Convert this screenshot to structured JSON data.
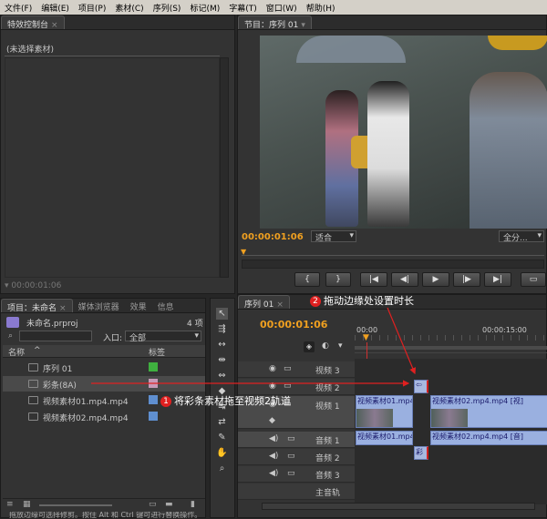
{
  "menu": [
    "文件(F)",
    "编辑(E)",
    "项目(P)",
    "素材(C)",
    "序列(S)",
    "标记(M)",
    "字幕(T)",
    "窗口(W)",
    "帮助(H)"
  ],
  "effect_controls": {
    "tab": "特效控制台",
    "no_clip": "(未选择素材)",
    "timecode": "00:00:01:06"
  },
  "program": {
    "tab": "节目：序列 01",
    "timecode": "00:00:01:06",
    "fit": "适合",
    "quality": "全分..."
  },
  "project": {
    "tabs": [
      "项目：未命名",
      "媒体浏览器",
      "效果",
      "信息"
    ],
    "file": "未命名.prproj",
    "count": "4 项",
    "in_label": "入口:",
    "in_value": "全部",
    "col_name": "名称",
    "col_label": "标签",
    "items": [
      {
        "name": "序列 01",
        "color": "#3fb03f"
      },
      {
        "name": "彩条(8A)",
        "color": "#c89ab8"
      },
      {
        "name": "视频素材01.mp4.mp4",
        "color": "#5f8fd0"
      },
      {
        "name": "视频素材02.mp4.mp4",
        "color": "#5f8fd0"
      }
    ]
  },
  "timeline": {
    "tab": "序列 01",
    "timecode": "00:00:01:06",
    "ruler": [
      "00:00",
      "00:00:15:00"
    ],
    "video_tracks": [
      "视频 3",
      "视频 2",
      "视频 1"
    ],
    "audio_tracks": [
      "音频 1",
      "音频 2",
      "音频 3"
    ],
    "master": "主音轨",
    "clip_v1a": "视频素材01.mp4",
    "clip_v1b": "视频素材02.mp4.mp4 [视]",
    "clip_a1a": "视频素材01.mp4",
    "clip_a1b": "视频素材02.mp4.mp4 [音]",
    "clip_bars_v": "彩",
    "clip_bars_a": "彩"
  },
  "annotations": {
    "a1": "将彩条素材拖至视频2轨道",
    "a2": "拖动边缘处设置时长",
    "n1": "1",
    "n2": "2"
  },
  "status": "拖放边缘可选择修剪。按住 Alt 和 Ctrl 键可进行替换操作。"
}
